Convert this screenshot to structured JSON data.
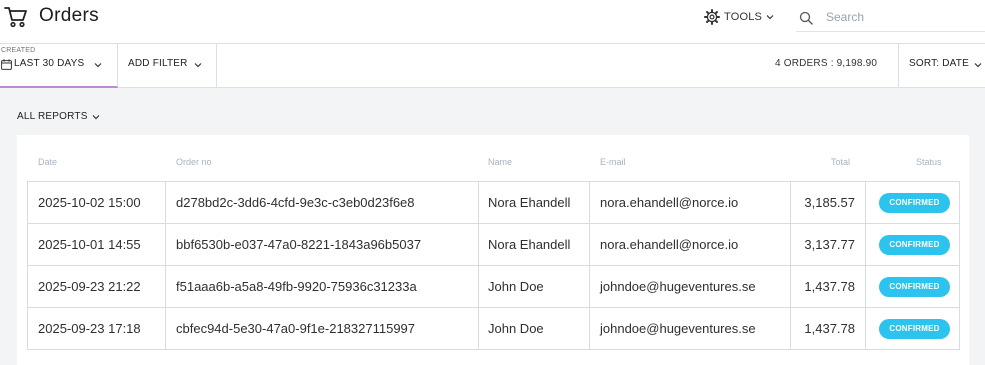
{
  "header": {
    "icon": "shopping-cart-icon",
    "title": "Orders",
    "tools_label": "TOOLS",
    "search_placeholder": "Search"
  },
  "filters": {
    "created_caption": "CREATED",
    "created_value": "LAST 30 DAYS",
    "add_filter_label": "ADD FILTER",
    "summary": "4 ORDERS : 9,198.90",
    "sort_label": "SORT: DATE",
    "active_tab_color": "#b98cd4"
  },
  "reports": {
    "label": "ALL REPORTS"
  },
  "table": {
    "columns": [
      "Date",
      "Order no",
      "Name",
      "E-mail",
      "Total",
      "Status"
    ],
    "rows": [
      {
        "date": "2025-10-02 15:00",
        "order_no": "d278bd2c-3dd6-4cfd-9e3c-c3eb0d23f6e8",
        "name": "Nora Ehandell",
        "email": "nora.ehandell@norce.io",
        "total": "3,185.57",
        "status": "CONFIRMED"
      },
      {
        "date": "2025-10-01 14:55",
        "order_no": "bbf6530b-e037-47a0-8221-1843a96b5037",
        "name": "Nora Ehandell",
        "email": "nora.ehandell@norce.io",
        "total": "3,137.77",
        "status": "CONFIRMED"
      },
      {
        "date": "2025-09-23 21:22",
        "order_no": "f51aaa6b-a5a8-49fb-9920-75936c31233a",
        "name": "John Doe",
        "email": "johndoe@hugeventures.se",
        "total": "1,437.78",
        "status": "CONFIRMED"
      },
      {
        "date": "2025-09-23 17:18",
        "order_no": "cbfec94d-5e30-47a0-9f1e-218327115997",
        "name": "John Doe",
        "email": "johndoe@hugeventures.se",
        "total": "1,437.78",
        "status": "CONFIRMED"
      }
    ],
    "status_color": "#2cc4ee"
  }
}
